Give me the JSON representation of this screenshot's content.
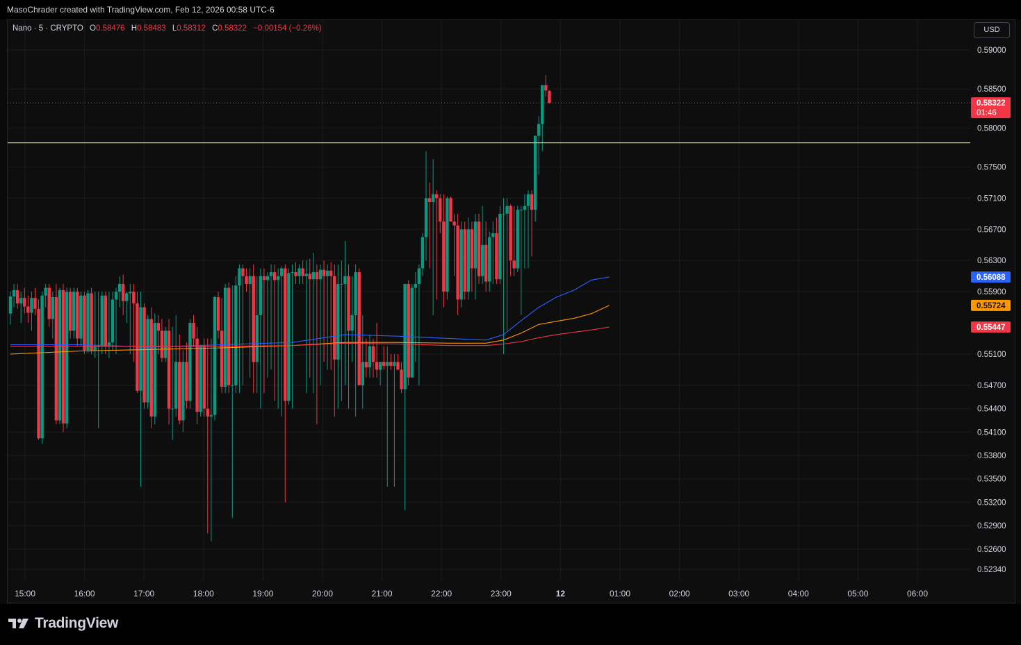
{
  "header": {
    "attribution": "MasoChrader created with TradingView.com, Feb 12, 2026 00:58 UTC-6"
  },
  "legend": {
    "symbol": "Nano · 5 · CRYPTO",
    "o_label": "O",
    "o_value": "0.58476",
    "h_label": "H",
    "h_value": "0.58483",
    "l_label": "L",
    "l_value": "0.58312",
    "c_label": "C",
    "c_value": "0.58322",
    "change": "−0.00154 (−0.26%)"
  },
  "currency_button": "USD",
  "brand": {
    "name": "TradingView"
  },
  "colors": {
    "up": "#089981",
    "down": "#f23645",
    "ma_blue": "#2962ff",
    "ma_orange": "#ff9800",
    "ma_red": "#f23645",
    "level_line": "#d4c553"
  },
  "chart_data": {
    "type": "candlestick",
    "y_axis": {
      "range": [
        0.522,
        0.5935
      ],
      "ticks": [
        "0.59000",
        "0.58500",
        "0.58000",
        "0.57500",
        "0.57100",
        "0.56700",
        "0.56300",
        "0.55900",
        "0.55100",
        "0.54700",
        "0.54400",
        "0.54100",
        "0.53800",
        "0.53500",
        "0.53200",
        "0.52900",
        "0.52600",
        "0.52340"
      ]
    },
    "x_axis": {
      "ticks": [
        "15:00",
        "16:00",
        "17:00",
        "18:00",
        "19:00",
        "20:00",
        "21:00",
        "22:00",
        "23:00",
        "12",
        "01:00",
        "02:00",
        "03:00",
        "04:00",
        "05:00",
        "06:00"
      ],
      "bold_tick": "12"
    },
    "price_labels": [
      {
        "value": "0.58322",
        "sub": "01:46",
        "color": "#f23645"
      },
      {
        "value": "0.56088",
        "color": "#2962ff"
      },
      {
        "value": "0.55724",
        "color": "#ff9800"
      },
      {
        "value": "0.55447",
        "color": "#f23645"
      }
    ],
    "last_price": 0.58322,
    "horizontal_level": 0.5781,
    "candles": [
      [
        0.5562,
        0.559,
        0.5548,
        0.5584
      ],
      [
        0.5584,
        0.56,
        0.557,
        0.5592
      ],
      [
        0.5592,
        0.56,
        0.5568,
        0.5575
      ],
      [
        0.5575,
        0.559,
        0.555,
        0.5582
      ],
      [
        0.5582,
        0.5595,
        0.5562,
        0.5571
      ],
      [
        0.5571,
        0.5585,
        0.555,
        0.5563
      ],
      [
        0.5563,
        0.559,
        0.554,
        0.5582
      ],
      [
        0.5582,
        0.5595,
        0.556,
        0.5568
      ],
      [
        0.5568,
        0.558,
        0.54,
        0.5402
      ],
      [
        0.5402,
        0.559,
        0.5395,
        0.5585
      ],
      [
        0.5585,
        0.56,
        0.557,
        0.5595
      ],
      [
        0.5595,
        0.56,
        0.5545,
        0.5555
      ],
      [
        0.5555,
        0.559,
        0.553,
        0.5583
      ],
      [
        0.5583,
        0.56,
        0.542,
        0.5425
      ],
      [
        0.5425,
        0.5595,
        0.542,
        0.5592
      ],
      [
        0.5592,
        0.56,
        0.541,
        0.5421
      ],
      [
        0.5421,
        0.5595,
        0.5415,
        0.559
      ],
      [
        0.559,
        0.5595,
        0.553,
        0.554
      ],
      [
        0.554,
        0.5595,
        0.553,
        0.559
      ],
      [
        0.559,
        0.5595,
        0.552,
        0.553
      ],
      [
        0.553,
        0.559,
        0.552,
        0.5585
      ],
      [
        0.5585,
        0.559,
        0.551,
        0.5515
      ],
      [
        0.5515,
        0.5592,
        0.5512,
        0.5588
      ],
      [
        0.5588,
        0.5595,
        0.551,
        0.5515
      ],
      [
        0.5515,
        0.559,
        0.5505,
        0.552
      ],
      [
        0.552,
        0.559,
        0.5415,
        0.552
      ],
      [
        0.552,
        0.559,
        0.551,
        0.5585
      ],
      [
        0.5585,
        0.559,
        0.551,
        0.552
      ],
      [
        0.552,
        0.559,
        0.5505,
        0.5525
      ],
      [
        0.5525,
        0.559,
        0.5515,
        0.558
      ],
      [
        0.558,
        0.5595,
        0.551,
        0.559
      ],
      [
        0.559,
        0.561,
        0.557,
        0.56
      ],
      [
        0.56,
        0.5612,
        0.556,
        0.5578
      ],
      [
        0.5578,
        0.559,
        0.555,
        0.5588
      ],
      [
        0.5588,
        0.56,
        0.551,
        0.559
      ],
      [
        0.559,
        0.56,
        0.55,
        0.5575
      ],
      [
        0.5575,
        0.559,
        0.546,
        0.5463
      ],
      [
        0.5463,
        0.559,
        0.534,
        0.557
      ],
      [
        0.557,
        0.5575,
        0.544,
        0.5448
      ],
      [
        0.5448,
        0.556,
        0.544,
        0.5555
      ],
      [
        0.5555,
        0.557,
        0.5415,
        0.543
      ],
      [
        0.543,
        0.5562,
        0.542,
        0.555
      ],
      [
        0.555,
        0.556,
        0.551,
        0.554
      ],
      [
        0.554,
        0.5555,
        0.55,
        0.5505
      ],
      [
        0.5505,
        0.5545,
        0.55,
        0.554
      ],
      [
        0.554,
        0.5555,
        0.542,
        0.544
      ],
      [
        0.544,
        0.5545,
        0.54,
        0.544
      ],
      [
        0.544,
        0.556,
        0.543,
        0.55
      ],
      [
        0.55,
        0.5535,
        0.542,
        0.5425
      ],
      [
        0.5425,
        0.5515,
        0.541,
        0.55
      ],
      [
        0.55,
        0.5525,
        0.544,
        0.545
      ],
      [
        0.545,
        0.5555,
        0.544,
        0.555
      ],
      [
        0.555,
        0.556,
        0.552,
        0.553
      ],
      [
        0.553,
        0.5545,
        0.542,
        0.5436
      ],
      [
        0.5436,
        0.5522,
        0.543,
        0.552
      ],
      [
        0.552,
        0.553,
        0.543,
        0.544
      ],
      [
        0.544,
        0.553,
        0.528,
        0.543
      ],
      [
        0.543,
        0.553,
        0.527,
        0.5432
      ],
      [
        0.5432,
        0.5585,
        0.5425,
        0.5583
      ],
      [
        0.5583,
        0.559,
        0.553,
        0.554
      ],
      [
        0.554,
        0.5582,
        0.546,
        0.5468
      ],
      [
        0.5468,
        0.56,
        0.546,
        0.5595
      ],
      [
        0.5595,
        0.5602,
        0.546,
        0.547
      ],
      [
        0.547,
        0.5598,
        0.53,
        0.547
      ],
      [
        0.547,
        0.561,
        0.546,
        0.5598
      ],
      [
        0.5598,
        0.5625,
        0.546,
        0.562
      ],
      [
        0.562,
        0.5625,
        0.547,
        0.561
      ],
      [
        0.561,
        0.562,
        0.559,
        0.56
      ],
      [
        0.56,
        0.562,
        0.548,
        0.561
      ],
      [
        0.561,
        0.5625,
        0.546,
        0.55
      ],
      [
        0.55,
        0.561,
        0.546,
        0.556
      ],
      [
        0.556,
        0.562,
        0.544,
        0.561
      ],
      [
        0.561,
        0.562,
        0.546,
        0.5605
      ],
      [
        0.5605,
        0.5615,
        0.548,
        0.561
      ],
      [
        0.561,
        0.5625,
        0.549,
        0.5615
      ],
      [
        0.5615,
        0.5625,
        0.545,
        0.5605
      ],
      [
        0.5605,
        0.562,
        0.544,
        0.561
      ],
      [
        0.561,
        0.5623,
        0.543,
        0.562
      ],
      [
        0.562,
        0.5625,
        0.532,
        0.545
      ],
      [
        0.545,
        0.562,
        0.5445,
        0.5614
      ],
      [
        0.5614,
        0.5625,
        0.544,
        0.5615
      ],
      [
        0.5615,
        0.5628,
        0.56,
        0.561
      ],
      [
        0.561,
        0.5625,
        0.56,
        0.562
      ],
      [
        0.562,
        0.563,
        0.56,
        0.561
      ],
      [
        0.561,
        0.563,
        0.546,
        0.5613
      ],
      [
        0.5613,
        0.5632,
        0.548,
        0.5606
      ],
      [
        0.5606,
        0.564,
        0.546,
        0.5615
      ],
      [
        0.5615,
        0.5625,
        0.542,
        0.5606
      ],
      [
        0.5606,
        0.5625,
        0.547,
        0.5618
      ],
      [
        0.5618,
        0.563,
        0.55,
        0.561
      ],
      [
        0.561,
        0.5625,
        0.549,
        0.5617
      ],
      [
        0.5617,
        0.5628,
        0.549,
        0.561
      ],
      [
        0.561,
        0.5625,
        0.543,
        0.5503
      ],
      [
        0.5503,
        0.5625,
        0.544,
        0.56
      ],
      [
        0.56,
        0.563,
        0.545,
        0.56
      ],
      [
        0.56,
        0.5655,
        0.547,
        0.561
      ],
      [
        0.561,
        0.5625,
        0.544,
        0.554
      ],
      [
        0.554,
        0.561,
        0.55,
        0.556
      ],
      [
        0.556,
        0.5625,
        0.543,
        0.5615
      ],
      [
        0.5615,
        0.562,
        0.548,
        0.547
      ],
      [
        0.547,
        0.556,
        0.544,
        0.55
      ],
      [
        0.55,
        0.553,
        0.548,
        0.5493
      ],
      [
        0.5493,
        0.5535,
        0.548,
        0.552
      ],
      [
        0.552,
        0.553,
        0.548,
        0.55
      ],
      [
        0.55,
        0.555,
        0.548,
        0.549
      ],
      [
        0.549,
        0.55,
        0.547,
        0.55
      ],
      [
        0.55,
        0.552,
        0.549,
        0.5495
      ],
      [
        0.5495,
        0.552,
        0.534,
        0.55
      ],
      [
        0.55,
        0.551,
        0.549,
        0.5495
      ],
      [
        0.5495,
        0.551,
        0.534,
        0.55
      ],
      [
        0.55,
        0.551,
        0.549,
        0.549
      ],
      [
        0.549,
        0.55,
        0.546,
        0.5465
      ],
      [
        0.5465,
        0.56,
        0.531,
        0.56
      ],
      [
        0.56,
        0.5605,
        0.547,
        0.548
      ],
      [
        0.548,
        0.56,
        0.548,
        0.5595
      ],
      [
        0.5595,
        0.5615,
        0.55,
        0.56
      ],
      [
        0.56,
        0.5625,
        0.547,
        0.562
      ],
      [
        0.562,
        0.5665,
        0.561,
        0.566
      ],
      [
        0.566,
        0.577,
        0.563,
        0.571
      ],
      [
        0.571,
        0.573,
        0.562,
        0.5705
      ],
      [
        0.5705,
        0.576,
        0.556,
        0.5715
      ],
      [
        0.5715,
        0.572,
        0.558,
        0.571
      ],
      [
        0.571,
        0.5715,
        0.5665,
        0.568
      ],
      [
        0.568,
        0.5715,
        0.557,
        0.559
      ],
      [
        0.559,
        0.5712,
        0.558,
        0.571
      ],
      [
        0.571,
        0.5712,
        0.568,
        0.568
      ],
      [
        0.568,
        0.569,
        0.561,
        0.5675
      ],
      [
        0.5675,
        0.569,
        0.556,
        0.558
      ],
      [
        0.558,
        0.568,
        0.557,
        0.567
      ],
      [
        0.567,
        0.568,
        0.558,
        0.559
      ],
      [
        0.559,
        0.5685,
        0.558,
        0.567
      ],
      [
        0.567,
        0.568,
        0.559,
        0.562
      ],
      [
        0.562,
        0.569,
        0.558,
        0.568
      ],
      [
        0.568,
        0.569,
        0.56,
        0.561
      ],
      [
        0.561,
        0.57,
        0.56,
        0.565
      ],
      [
        0.565,
        0.568,
        0.559,
        0.5603
      ],
      [
        0.5603,
        0.5667,
        0.559,
        0.566
      ],
      [
        0.566,
        0.568,
        0.56,
        0.5665
      ],
      [
        0.5665,
        0.5685,
        0.56,
        0.5606
      ],
      [
        0.5606,
        0.57,
        0.56,
        0.569
      ],
      [
        0.569,
        0.571,
        0.551,
        0.569
      ],
      [
        0.569,
        0.571,
        0.554,
        0.57
      ],
      [
        0.57,
        0.5702,
        0.561,
        0.563
      ],
      [
        0.563,
        0.57,
        0.561,
        0.562
      ],
      [
        0.562,
        0.57,
        0.5615,
        0.5695
      ],
      [
        0.5695,
        0.57,
        0.556,
        0.5695
      ],
      [
        0.5695,
        0.5715,
        0.562,
        0.57
      ],
      [
        0.57,
        0.572,
        0.562,
        0.5715
      ],
      [
        0.5715,
        0.572,
        0.5635,
        0.5695
      ],
      [
        0.5695,
        0.579,
        0.568,
        0.579
      ],
      [
        0.579,
        0.5815,
        0.574,
        0.5805
      ],
      [
        0.5805,
        0.5855,
        0.577,
        0.5855
      ],
      [
        0.5855,
        0.5868,
        0.584,
        0.5848
      ],
      [
        0.58476,
        0.58483,
        0.58312,
        0.58322
      ]
    ],
    "ma_series": [
      {
        "color": "#2962ff",
        "points": [
          [
            0,
            0.5522
          ],
          [
            20,
            0.5522
          ],
          [
            40,
            0.5519
          ],
          [
            60,
            0.5522
          ],
          [
            80,
            0.5525
          ],
          [
            95,
            0.5535
          ],
          [
            110,
            0.5533
          ],
          [
            125,
            0.553
          ],
          [
            135,
            0.5528
          ],
          [
            140,
            0.5535
          ],
          [
            145,
            0.5553
          ],
          [
            150,
            0.557
          ],
          [
            155,
            0.5583
          ],
          [
            160,
            0.5592
          ],
          [
            165,
            0.5605
          ],
          [
            170,
            0.56088
          ]
        ]
      },
      {
        "color": "#ff9800",
        "points": [
          [
            0,
            0.551
          ],
          [
            20,
            0.5514
          ],
          [
            40,
            0.5516
          ],
          [
            60,
            0.5518
          ],
          [
            80,
            0.5521
          ],
          [
            95,
            0.5525
          ],
          [
            110,
            0.5525
          ],
          [
            125,
            0.5524
          ],
          [
            135,
            0.5524
          ],
          [
            140,
            0.5528
          ],
          [
            145,
            0.5537
          ],
          [
            150,
            0.5548
          ],
          [
            155,
            0.5552
          ],
          [
            160,
            0.5556
          ],
          [
            165,
            0.5562
          ],
          [
            170,
            0.55724
          ]
        ]
      },
      {
        "color": "#f23645",
        "points": [
          [
            0,
            0.552
          ],
          [
            20,
            0.552
          ],
          [
            40,
            0.552
          ],
          [
            60,
            0.552
          ],
          [
            80,
            0.5521
          ],
          [
            95,
            0.5524
          ],
          [
            110,
            0.5523
          ],
          [
            125,
            0.5521
          ],
          [
            135,
            0.5521
          ],
          [
            140,
            0.5523
          ],
          [
            145,
            0.5526
          ],
          [
            150,
            0.5531
          ],
          [
            155,
            0.5535
          ],
          [
            160,
            0.5538
          ],
          [
            165,
            0.5541
          ],
          [
            170,
            0.55447
          ]
        ]
      }
    ]
  }
}
